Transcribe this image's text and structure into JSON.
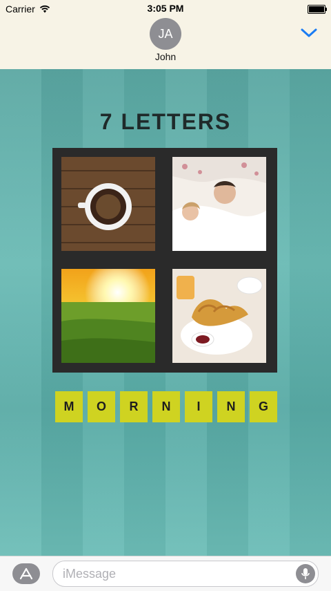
{
  "status": {
    "carrier": "Carrier",
    "time": "3:05 PM"
  },
  "contact": {
    "initials": "JA",
    "name": "John"
  },
  "game": {
    "title": "7 LETTERS",
    "images": [
      {
        "name": "coffee-cup-image"
      },
      {
        "name": "couple-waking-image"
      },
      {
        "name": "sunrise-field-image"
      },
      {
        "name": "croissant-breakfast-image"
      }
    ],
    "answer": [
      "M",
      "O",
      "R",
      "N",
      "I",
      "N",
      "G"
    ]
  },
  "composer": {
    "placeholder": "iMessage"
  },
  "colors": {
    "accent": "#1a7cf3",
    "tile": "#cfd321"
  }
}
